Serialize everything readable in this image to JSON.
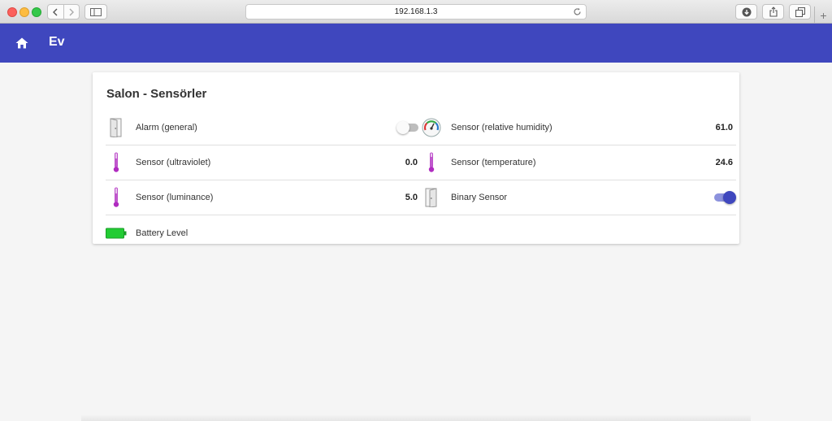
{
  "browser": {
    "url": "192.168.1.3"
  },
  "header": {
    "title": "Ev",
    "home_icon": "home-icon",
    "color": "#3f47be"
  },
  "card": {
    "title": "Salon - Sensörler",
    "left": [
      {
        "label": "Alarm (general)",
        "icon": "door-icon",
        "control": "toggle",
        "state": "off"
      },
      {
        "label": "Sensor (ultraviolet)",
        "icon": "thermometer-icon",
        "value": "0.0"
      },
      {
        "label": "Sensor (luminance)",
        "icon": "thermometer-icon",
        "value": "5.0"
      },
      {
        "label": "Battery Level",
        "icon": "battery-icon"
      }
    ],
    "right": [
      {
        "label": "Sensor (relative humidity)",
        "icon": "gauge-icon",
        "value": "61.0"
      },
      {
        "label": "Sensor (temperature)",
        "icon": "thermometer-icon",
        "value": "24.6"
      },
      {
        "label": "Binary Sensor",
        "icon": "door-icon",
        "control": "toggle",
        "state": "on"
      }
    ]
  },
  "colors": {
    "accent": "#3f47be",
    "thermometer": "#b02cc0",
    "battery": "#22cc33"
  }
}
